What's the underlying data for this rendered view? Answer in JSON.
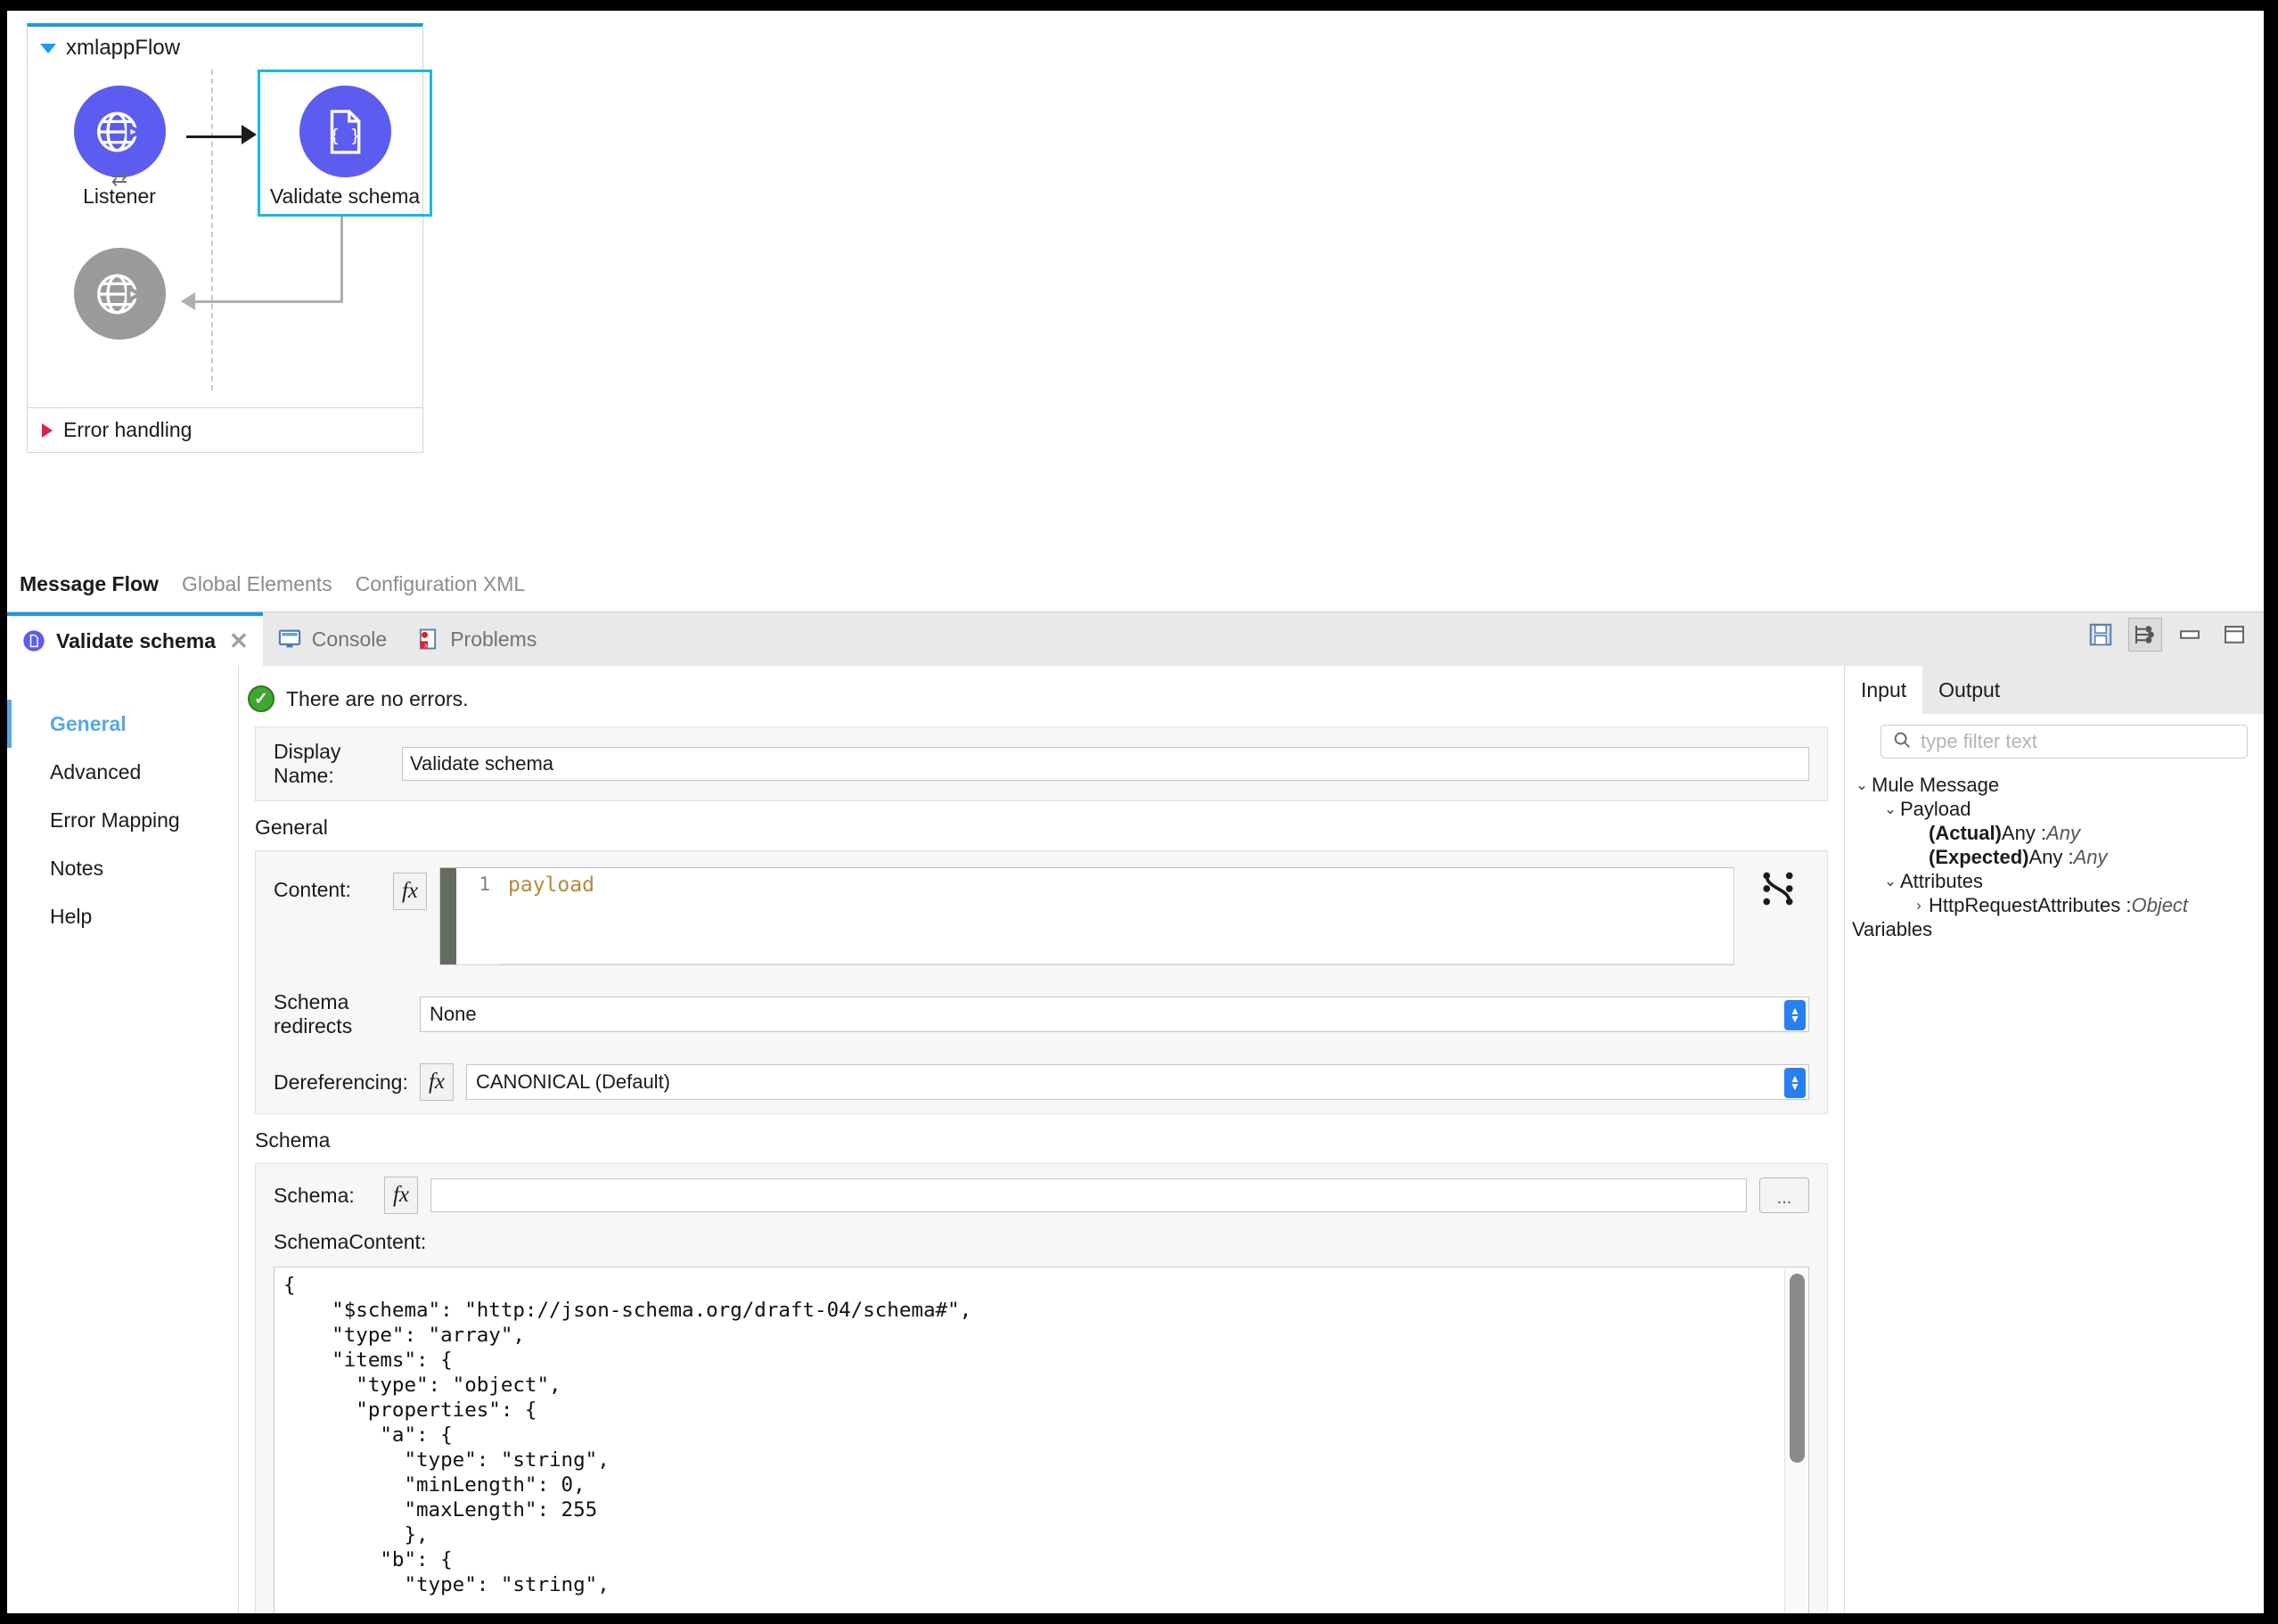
{
  "flow": {
    "name": "xmlappFlow",
    "nodes": [
      {
        "id": "listener",
        "label": "Listener",
        "icon": "globe-arrow-icon",
        "color": "#5c5cf0",
        "selected": false
      },
      {
        "id": "validate-schema",
        "label": "Validate schema",
        "icon": "json-document-icon",
        "color": "#5c5cf0",
        "selected": true
      },
      {
        "id": "listener-response",
        "label": "",
        "icon": "globe-arrow-icon",
        "color": "#9a9a9a",
        "selected": false
      }
    ],
    "error_handling_label": "Error handling"
  },
  "editor_tabs": [
    {
      "label": "Message Flow",
      "active": true
    },
    {
      "label": "Global Elements",
      "active": false
    },
    {
      "label": "Configuration XML",
      "active": false
    }
  ],
  "panel_tabs": [
    {
      "label": "Validate schema",
      "icon": "mule-component-icon",
      "active": true,
      "closeable": true
    },
    {
      "label": "Console",
      "icon": "console-icon",
      "active": false,
      "closeable": false
    },
    {
      "label": "Problems",
      "icon": "problems-icon",
      "active": false,
      "closeable": false
    }
  ],
  "panel_toolbar": [
    {
      "name": "save-button",
      "title": "Save"
    },
    {
      "name": "link-with-editor-button",
      "title": "Link with Editor",
      "pressed": true
    },
    {
      "name": "minimize-button",
      "title": "Minimize"
    },
    {
      "name": "maximize-button",
      "title": "Maximize"
    }
  ],
  "nav": {
    "items": [
      {
        "label": "General",
        "active": true
      },
      {
        "label": "Advanced",
        "active": false
      },
      {
        "label": "Error Mapping",
        "active": false
      },
      {
        "label": "Notes",
        "active": false
      },
      {
        "label": "Help",
        "active": false
      }
    ]
  },
  "form": {
    "status": "There are no errors.",
    "display_name_label": "Display Name:",
    "display_name_value": "Validate schema",
    "general_section": "General",
    "content_label": "Content:",
    "content_line_number": "1",
    "content_value": "payload",
    "fx_label": "fx",
    "schema_redirects_label": "Schema redirects",
    "schema_redirects_value": "None",
    "dereferencing_label": "Dereferencing:",
    "dereferencing_value": "CANONICAL (Default)",
    "schema_section": "Schema",
    "schema_label": "Schema:",
    "schema_value": "",
    "browse_button_label": "...",
    "schema_content_label": "SchemaContent:",
    "schema_content_value": "{\n    \"$schema\": \"http://json-schema.org/draft-04/schema#\",\n    \"type\": \"array\",\n    \"items\": {\n      \"type\": \"object\",\n      \"properties\": {\n        \"a\": {\n          \"type\": \"string\",\n          \"minLength\": 0,\n          \"maxLength\": 255\n          },\n        \"b\": {\n          \"type\": \"string\","
  },
  "side": {
    "tabs": [
      {
        "label": "Input",
        "active": true
      },
      {
        "label": "Output",
        "active": false
      }
    ],
    "filter_placeholder": "type filter text",
    "tree": [
      {
        "indent": 0,
        "chevron": "down",
        "label": "Mule Message",
        "bold_prefix": "",
        "type": ""
      },
      {
        "indent": 1,
        "chevron": "down",
        "label": "Payload",
        "bold_prefix": "",
        "type": ""
      },
      {
        "indent": 2,
        "chevron": "none",
        "label": " Any : ",
        "bold_prefix": "(Actual)",
        "type": "Any"
      },
      {
        "indent": 2,
        "chevron": "none",
        "label": " Any : ",
        "bold_prefix": "(Expected)",
        "type": "Any"
      },
      {
        "indent": 1,
        "chevron": "down",
        "label": "Attributes",
        "bold_prefix": "",
        "type": ""
      },
      {
        "indent": 2,
        "chevron": "right",
        "label": "HttpRequestAttributes : ",
        "bold_prefix": "",
        "type": "Object"
      },
      {
        "indent": 0,
        "chevron": "none",
        "label": "Variables",
        "bold_prefix": "",
        "type": ""
      }
    ]
  },
  "colors": {
    "accent_blue": "#1a9ae0",
    "selection_cyan": "#17b9e8",
    "node_purple": "#5c5cf0",
    "node_gray": "#9a9a9a",
    "nav_active": "#57a8e8",
    "error_red": "#e0214c",
    "code_orange": "#b5893a",
    "status_green": "#3fa72f"
  }
}
